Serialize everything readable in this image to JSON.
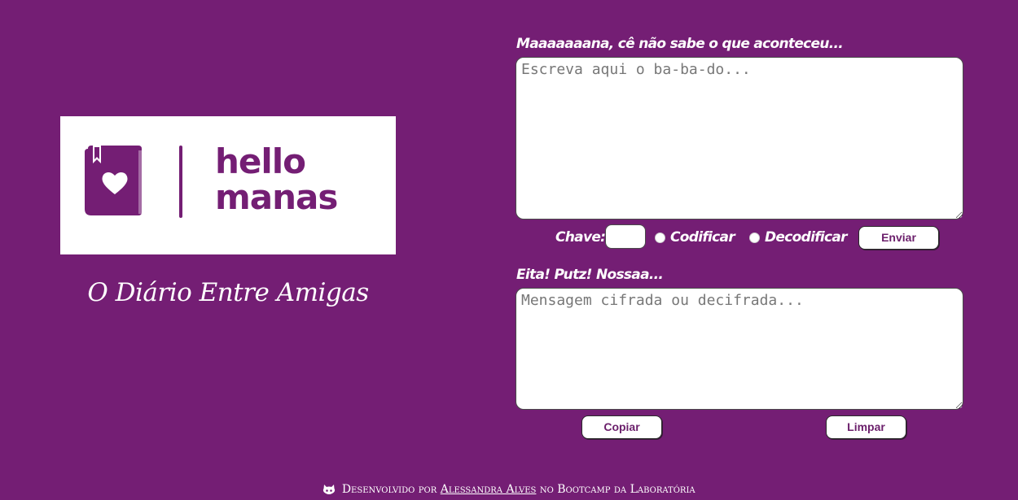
{
  "theme": {
    "background": "#741e74",
    "brand_purple": "#741e74",
    "button_text": "#6b1f6b"
  },
  "logo": {
    "brand_line1": "hello",
    "brand_line2": "manas",
    "icon": "heart-book-icon"
  },
  "tagline": "O Diário Entre Amigas",
  "composer": {
    "label": "Maaaaaaana, cê não sabe o que aconteceu...",
    "placeholder": "Escreva aqui o ba-ba-do...",
    "value": ""
  },
  "controls": {
    "key_label": "Chave:",
    "key_value": "",
    "encode_label": "Codificar",
    "decode_label": "Decodificar",
    "send_button": "Enviar"
  },
  "result": {
    "label": "Eita! Putz! Nossaa...",
    "placeholder": "Mensagem cifrada ou decifrada...",
    "value": "",
    "copy_button": "Copiar",
    "clear_button": "Limpar"
  },
  "footer": {
    "icon": "github-cat-icon",
    "prefix": "Desenvolvido por",
    "author": "Alessandra Alves",
    "suffix": "no Bootcamp da Laboratória"
  }
}
